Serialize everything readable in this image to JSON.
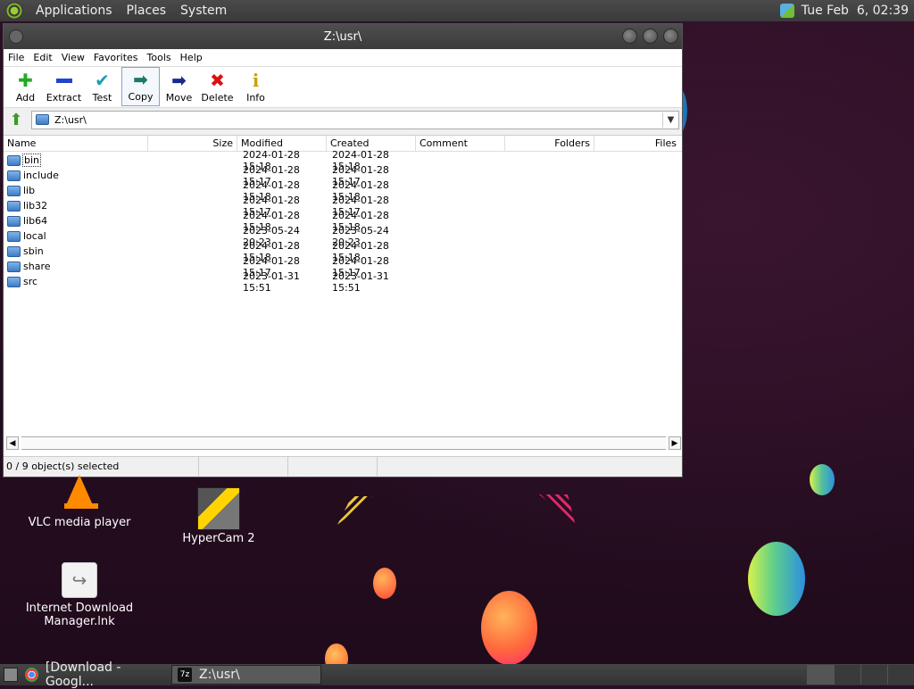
{
  "top_panel": {
    "menus": [
      "Applications",
      "Places",
      "System"
    ],
    "clock": "Tue Feb  6, 02:39"
  },
  "window": {
    "title": "Z:\\usr\\",
    "menubar": [
      "File",
      "Edit",
      "View",
      "Favorites",
      "Tools",
      "Help"
    ],
    "toolbar": [
      {
        "label": "Add",
        "icon": "plus-icon",
        "color": "#22aa22"
      },
      {
        "label": "Extract",
        "icon": "minus-icon",
        "color": "#2244cc"
      },
      {
        "label": "Test",
        "icon": "check-icon",
        "color": "#1aa0b0"
      },
      {
        "label": "Copy",
        "icon": "copy-arrow-icon",
        "color": "#1a7a6a"
      },
      {
        "label": "Move",
        "icon": "move-arrow-icon",
        "color": "#1a2a8a"
      },
      {
        "label": "Delete",
        "icon": "x-icon",
        "color": "#dd1111"
      },
      {
        "label": "Info",
        "icon": "info-icon",
        "color": "#c9a200"
      }
    ],
    "address": "Z:\\usr\\",
    "columns": [
      "Name",
      "Size",
      "Modified",
      "Created",
      "Comment",
      "Folders",
      "Files"
    ],
    "rows": [
      {
        "name": "bin",
        "modified": "2024-01-28 15:18",
        "created": "2024-01-28 15:18"
      },
      {
        "name": "include",
        "modified": "2024-01-28 15:17",
        "created": "2024-01-28 15:17"
      },
      {
        "name": "lib",
        "modified": "2024-01-28 15:18",
        "created": "2024-01-28 15:18"
      },
      {
        "name": "lib32",
        "modified": "2024-01-28 15:17",
        "created": "2024-01-28 15:17"
      },
      {
        "name": "lib64",
        "modified": "2024-01-28 15:18",
        "created": "2024-01-28 15:18"
      },
      {
        "name": "local",
        "modified": "2023-05-24 20:23",
        "created": "2023-05-24 20:23"
      },
      {
        "name": "sbin",
        "modified": "2024-01-28 15:18",
        "created": "2024-01-28 15:18"
      },
      {
        "name": "share",
        "modified": "2024-01-28 15:17",
        "created": "2024-01-28 15:17"
      },
      {
        "name": "src",
        "modified": "2023-01-31 15:51",
        "created": "2023-01-31 15:51"
      }
    ],
    "status": "0 / 9 object(s) selected"
  },
  "desktop_icons": {
    "vlc": "VLC media player",
    "hypercam": "HyperCam 2",
    "idm": "Internet Download Manager.lnk"
  },
  "taskbar": {
    "tasks": [
      "[Download - Googl...",
      "Z:\\usr\\"
    ],
    "sevenzip_badge": "7z"
  }
}
